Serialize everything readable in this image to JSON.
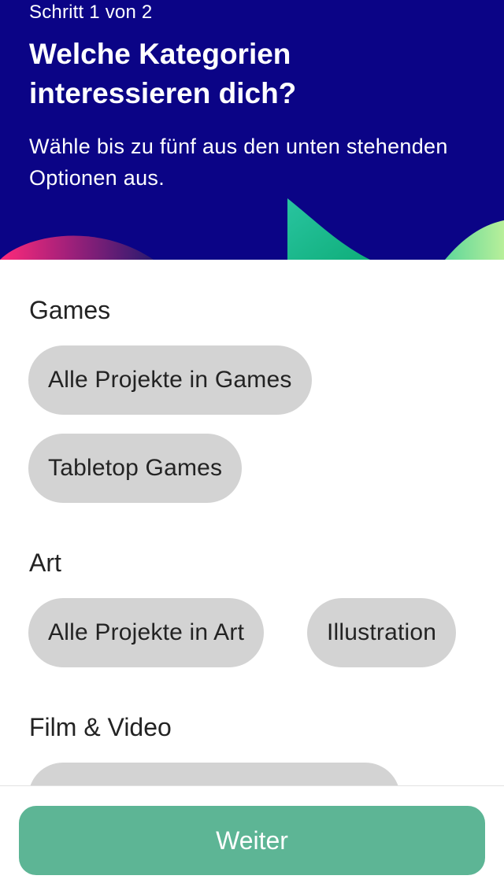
{
  "header": {
    "step": "Schritt 1 von 2",
    "title": "Welche Kategorien interessieren dich?",
    "subtitle": "Wähle bis zu fünf aus den unten stehenden Optionen aus."
  },
  "sections": [
    {
      "title": "Games",
      "chips": [
        "Alle Projekte in Games",
        "Tabletop Games"
      ]
    },
    {
      "title": "Art",
      "chips": [
        "Alle Projekte in Art",
        "Illustration"
      ]
    },
    {
      "title": "Film & Video",
      "chips": [
        ""
      ]
    }
  ],
  "footer": {
    "next_label": "Weiter"
  },
  "colors": {
    "header_bg": "#0b0486",
    "chip_bg": "#d3d3d3",
    "button_bg": "#5db595"
  }
}
